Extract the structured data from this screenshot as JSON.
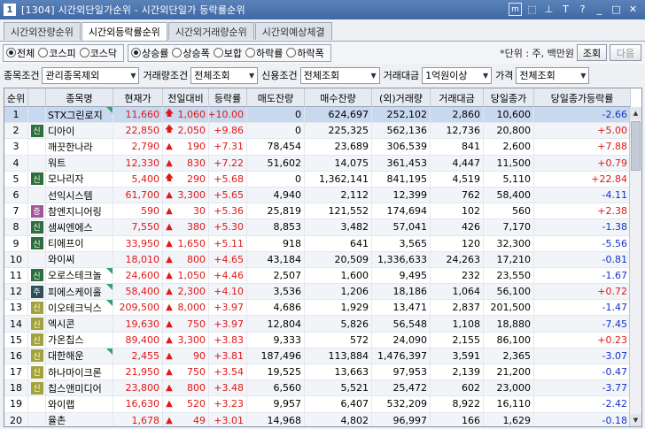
{
  "window": {
    "number": "1",
    "title": "[1304] 시간외단일가순위 - 시간외단일가 등락률순위",
    "tool_icons": [
      "m",
      "⬚",
      "▲",
      "T",
      "?",
      "_",
      "□",
      "✕"
    ]
  },
  "tabs": [
    {
      "label": "시간외잔량순위",
      "active": false
    },
    {
      "label": "시간외등락률순위",
      "active": true
    },
    {
      "label": "시간외거래량순위",
      "active": false
    },
    {
      "label": "시간외예상체결",
      "active": false
    }
  ],
  "market_radios": [
    {
      "label": "전체",
      "checked": true
    },
    {
      "label": "코스피",
      "checked": false
    },
    {
      "label": "코스닥",
      "checked": false
    }
  ],
  "direction_radios": [
    {
      "label": "상승률",
      "checked": true
    },
    {
      "label": "상승폭",
      "checked": false
    },
    {
      "label": "보합",
      "checked": false
    },
    {
      "label": "하락률",
      "checked": false
    },
    {
      "label": "하락폭",
      "checked": false
    }
  ],
  "unit_text": "*단위 : 주, 백만원",
  "buttons": {
    "query": "조회",
    "next": "다음"
  },
  "filters": {
    "stock_cond_label": "종목조건",
    "stock_cond_value": "관리종목제외",
    "volume_cond_label": "거래량조건",
    "volume_cond_value": "전체조회",
    "credit_cond_label": "신용조건",
    "credit_cond_value": "전체조회",
    "amount_label": "거래대금",
    "amount_value": "1억원이상",
    "price_label": "가격",
    "price_value": "전체조회"
  },
  "colors": {
    "up": "#e01818",
    "down": "#1432c8",
    "selected_row": "#c8d8ee"
  },
  "table": {
    "headers": [
      "순위",
      "",
      "종목명",
      "현재가",
      "전일대비",
      "등락률",
      "매도잔량",
      "매수잔량",
      "(외)거래량",
      "거래대금",
      "당일종가",
      "당일종가등락률"
    ],
    "rows": [
      {
        "rank": "1",
        "badge": "",
        "name": "STX그린로지",
        "corner": true,
        "price": "11,660",
        "icon": "up-arrow",
        "diff": "1,060",
        "rate": "+10.00",
        "ask": "0",
        "bid": "624,697",
        "vol": "252,102",
        "amt": "2,860",
        "close": "10,600",
        "close_rate": "-2.66"
      },
      {
        "rank": "2",
        "badge": "신",
        "name": "디아이",
        "corner": false,
        "price": "22,850",
        "icon": "up-arrow",
        "diff": "2,050",
        "rate": "+9.86",
        "ask": "0",
        "bid": "225,325",
        "vol": "562,136",
        "amt": "12,736",
        "close": "20,800",
        "close_rate": "+5.00"
      },
      {
        "rank": "3",
        "badge": "",
        "name": "깨끗한나라",
        "corner": false,
        "price": "2,790",
        "icon": "triangle-up",
        "diff": "190",
        "rate": "+7.31",
        "ask": "78,454",
        "bid": "23,689",
        "vol": "306,539",
        "amt": "841",
        "close": "2,600",
        "close_rate": "+7.88"
      },
      {
        "rank": "4",
        "badge": "",
        "name": "워트",
        "corner": false,
        "price": "12,330",
        "icon": "triangle-up",
        "diff": "830",
        "rate": "+7.22",
        "ask": "51,602",
        "bid": "14,075",
        "vol": "361,453",
        "amt": "4,447",
        "close": "11,500",
        "close_rate": "+0.79"
      },
      {
        "rank": "5",
        "badge": "신",
        "name": "모나리자",
        "corner": false,
        "price": "5,400",
        "icon": "up-arrow",
        "diff": "290",
        "rate": "+5.68",
        "ask": "0",
        "bid": "1,362,141",
        "vol": "841,195",
        "amt": "4,519",
        "close": "5,110",
        "close_rate": "+22.84"
      },
      {
        "rank": "6",
        "badge": "",
        "name": "선익시스템",
        "corner": false,
        "price": "61,700",
        "icon": "triangle-up",
        "diff": "3,300",
        "rate": "+5.65",
        "ask": "4,940",
        "bid": "2,112",
        "vol": "12,399",
        "amt": "762",
        "close": "58,400",
        "close_rate": "-4.11"
      },
      {
        "rank": "7",
        "badge": "증",
        "name": "참엔지니어링",
        "corner": false,
        "price": "590",
        "icon": "triangle-up",
        "diff": "30",
        "rate": "+5.36",
        "ask": "25,819",
        "bid": "121,552",
        "vol": "174,694",
        "amt": "102",
        "close": "560",
        "close_rate": "+2.38"
      },
      {
        "rank": "8",
        "badge": "신",
        "name": "샘씨엔에스",
        "corner": false,
        "price": "7,550",
        "icon": "triangle-up",
        "diff": "380",
        "rate": "+5.30",
        "ask": "8,853",
        "bid": "3,482",
        "vol": "57,041",
        "amt": "426",
        "close": "7,170",
        "close_rate": "-1.38"
      },
      {
        "rank": "9",
        "badge": "신",
        "name": "티에프이",
        "corner": false,
        "price": "33,950",
        "icon": "triangle-up",
        "diff": "1,650",
        "rate": "+5.11",
        "ask": "918",
        "bid": "641",
        "vol": "3,565",
        "amt": "120",
        "close": "32,300",
        "close_rate": "-5.56"
      },
      {
        "rank": "10",
        "badge": "",
        "name": "와이씨",
        "corner": false,
        "price": "18,010",
        "icon": "triangle-up",
        "diff": "800",
        "rate": "+4.65",
        "ask": "43,184",
        "bid": "20,509",
        "vol": "1,336,633",
        "amt": "24,263",
        "close": "17,210",
        "close_rate": "-0.81"
      },
      {
        "rank": "11",
        "badge": "신",
        "name": "오로스테크놀",
        "corner": true,
        "price": "24,600",
        "icon": "triangle-up",
        "diff": "1,050",
        "rate": "+4.46",
        "ask": "2,507",
        "bid": "1,600",
        "vol": "9,495",
        "amt": "232",
        "close": "23,550",
        "close_rate": "-1.67"
      },
      {
        "rank": "12",
        "badge": "주",
        "name": "피에스케이홀",
        "corner": true,
        "price": "58,400",
        "icon": "triangle-up",
        "diff": "2,300",
        "rate": "+4.10",
        "ask": "3,536",
        "bid": "1,206",
        "vol": "18,186",
        "amt": "1,064",
        "close": "56,100",
        "close_rate": "+0.72"
      },
      {
        "rank": "13",
        "badge": "신",
        "name": "이오테크닉스",
        "corner": true,
        "price": "209,500",
        "icon": "triangle-up",
        "diff": "8,000",
        "rate": "+3.97",
        "ask": "4,686",
        "bid": "1,929",
        "vol": "13,471",
        "amt": "2,837",
        "close": "201,500",
        "close_rate": "-1.47"
      },
      {
        "rank": "14",
        "badge": "신",
        "name": "엑시콘",
        "corner": false,
        "price": "19,630",
        "icon": "triangle-up",
        "diff": "750",
        "rate": "+3.97",
        "ask": "12,804",
        "bid": "5,826",
        "vol": "56,548",
        "amt": "1,108",
        "close": "18,880",
        "close_rate": "-7.45"
      },
      {
        "rank": "15",
        "badge": "신",
        "name": "가온칩스",
        "corner": false,
        "price": "89,400",
        "icon": "triangle-up",
        "diff": "3,300",
        "rate": "+3.83",
        "ask": "9,333",
        "bid": "572",
        "vol": "24,090",
        "amt": "2,155",
        "close": "86,100",
        "close_rate": "+0.23"
      },
      {
        "rank": "16",
        "badge": "신",
        "name": "대한해운",
        "corner": true,
        "price": "2,455",
        "icon": "triangle-up",
        "diff": "90",
        "rate": "+3.81",
        "ask": "187,496",
        "bid": "113,884",
        "vol": "1,476,397",
        "amt": "3,591",
        "close": "2,365",
        "close_rate": "-3.07"
      },
      {
        "rank": "17",
        "badge": "신",
        "name": "하나마이크론",
        "corner": false,
        "price": "21,950",
        "icon": "triangle-up",
        "diff": "750",
        "rate": "+3.54",
        "ask": "19,525",
        "bid": "13,663",
        "vol": "97,953",
        "amt": "2,139",
        "close": "21,200",
        "close_rate": "-0.47"
      },
      {
        "rank": "18",
        "badge": "신",
        "name": "칩스앤미디어",
        "corner": false,
        "price": "23,800",
        "icon": "triangle-up",
        "diff": "800",
        "rate": "+3.48",
        "ask": "6,560",
        "bid": "5,521",
        "vol": "25,472",
        "amt": "602",
        "close": "23,000",
        "close_rate": "-3.77"
      },
      {
        "rank": "19",
        "badge": "",
        "name": "와이랩",
        "corner": false,
        "price": "16,630",
        "icon": "triangle-up",
        "diff": "520",
        "rate": "+3.23",
        "ask": "9,957",
        "bid": "6,407",
        "vol": "532,209",
        "amt": "8,922",
        "close": "16,110",
        "close_rate": "-2.42"
      },
      {
        "rank": "20",
        "badge": "",
        "name": "율촌",
        "corner": false,
        "price": "1,678",
        "icon": "triangle-up",
        "diff": "49",
        "rate": "+3.01",
        "ask": "14,968",
        "bid": "4,802",
        "vol": "96,997",
        "amt": "166",
        "close": "1,629",
        "close_rate": "-0.18"
      }
    ]
  }
}
